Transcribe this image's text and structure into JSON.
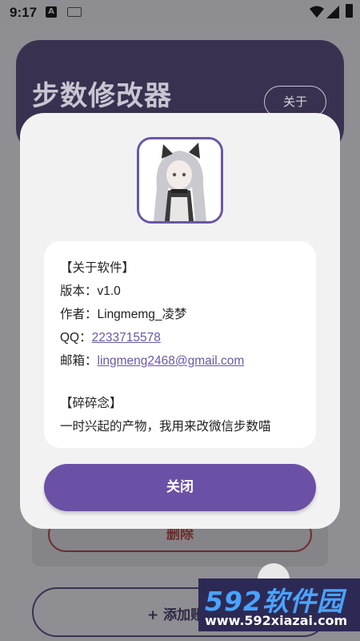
{
  "status_bar": {
    "time": "9:17",
    "notification_icon_letter": "A",
    "icons": [
      "a-notification-icon",
      "keyboard-icon",
      "wifi-icon",
      "cellular-icon",
      "battery-icon"
    ]
  },
  "app": {
    "title": "步数修改器",
    "about_button": "关于",
    "delete_button": "删除",
    "add_button": "+ 添加账"
  },
  "dialog": {
    "avatar": "avatar-image",
    "info_lines": {
      "section_about": "【关于软件】",
      "version": "版本：v1.0",
      "author": "作者：Lingmemg_凌梦",
      "qq_label": "QQ：",
      "qq_value": "2233715578",
      "email_label": "邮箱：",
      "email_value": "lingmeng2468@gmail.com",
      "section_notes": "【碎碎念】",
      "notes": "一时兴起的产物，我用来改微信步数喵"
    },
    "close_button": "关闭"
  },
  "watermark": {
    "logo_text": "592软件园",
    "url": "www.592xiazai.com"
  },
  "colors": {
    "accent": "#6b51a6",
    "dialog_bg": "#f2f2f3",
    "header_dim": "#3a3150",
    "link": "#6b57a5"
  }
}
